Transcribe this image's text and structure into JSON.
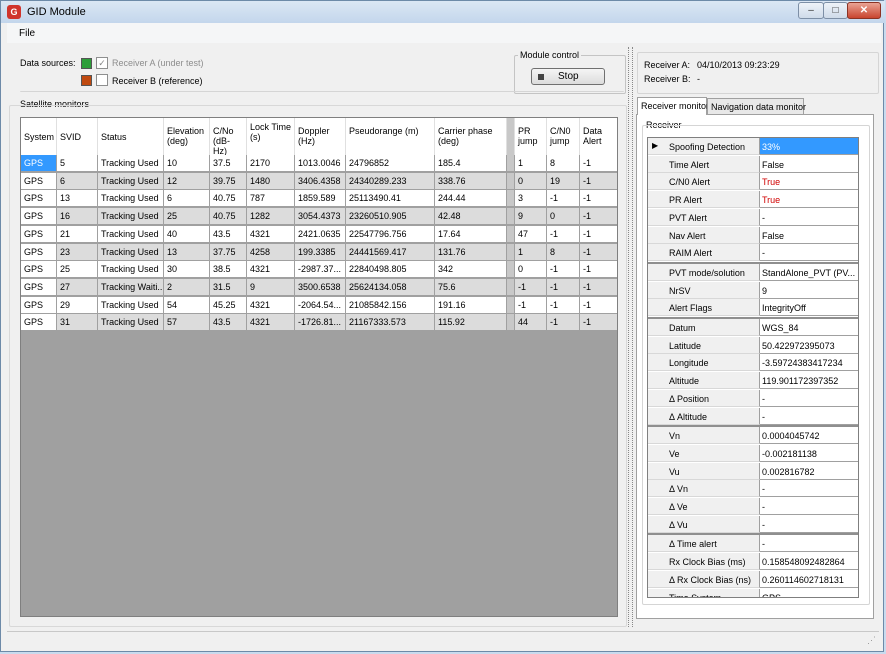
{
  "window": {
    "title": "GID Module",
    "app_icon_letter": "G",
    "min_glyph": "–",
    "max_glyph": "□",
    "close_glyph": "✕"
  },
  "menu": {
    "file": "File"
  },
  "data_sources": {
    "label": "Data sources:",
    "receiver_a": {
      "label": "Receiver A (under test)",
      "checked": true,
      "color": "#2e9e3a"
    },
    "receiver_b": {
      "label": "Receiver B (reference)",
      "checked": false,
      "color": "#c04a10"
    },
    "check_glyph": "✓"
  },
  "module_control": {
    "title": "Module control",
    "stop_label": "Stop",
    "stop_icon": "stop-square-icon"
  },
  "receiver_info": {
    "a_label": "Receiver A:",
    "a_value": "04/10/2013 09:23:29",
    "b_label": "Receiver B:",
    "b_value": "-"
  },
  "satellite_monitors": {
    "title": "Satellite monitors",
    "columns": {
      "system": "System",
      "svid": "SVID",
      "status": "Status",
      "elevation": "Elevation (deg)",
      "cno": "C/No (dB-Hz)",
      "lock": "Lock Time (s)",
      "doppler": "Doppler (Hz)",
      "pseudorange": "Pseudorange (m)",
      "carrier": "Carrier phase (deg)",
      "pr_jump": "PR jump",
      "cn0_jump": "C/N0 jump",
      "data_alert": "Data Alert"
    },
    "rows": [
      [
        "GPS",
        "5",
        "Tracking Used",
        "10",
        "37.5",
        "2170",
        "1013.0046",
        "24796852",
        "185.4",
        "1",
        "8",
        "-1"
      ],
      [
        "GPS",
        "6",
        "Tracking Used",
        "12",
        "39.75",
        "1480",
        "3406.4358",
        "24340289.233",
        "338.76",
        "0",
        "19",
        "-1"
      ],
      [
        "GPS",
        "13",
        "Tracking Used",
        "6",
        "40.75",
        "787",
        "1859.589",
        "25113490.41",
        "244.44",
        "3",
        "-1",
        "-1"
      ],
      [
        "GPS",
        "16",
        "Tracking Used",
        "25",
        "40.75",
        "1282",
        "3054.4373",
        "23260510.905",
        "42.48",
        "9",
        "0",
        "-1"
      ],
      [
        "GPS",
        "21",
        "Tracking Used",
        "40",
        "43.5",
        "4321",
        "2421.0635",
        "22547796.756",
        "17.64",
        "47",
        "-1",
        "-1"
      ],
      [
        "GPS",
        "23",
        "Tracking Used",
        "13",
        "37.75",
        "4258",
        "199.3385",
        "24441569.417",
        "131.76",
        "1",
        "8",
        "-1"
      ],
      [
        "GPS",
        "25",
        "Tracking Used",
        "30",
        "38.5",
        "4321",
        "-2987.37...",
        "22840498.805",
        "342",
        "0",
        "-1",
        "-1"
      ],
      [
        "GPS",
        "27",
        "Tracking Waiti...",
        "2",
        "31.5",
        "9",
        "3500.6538",
        "25624134.058",
        "75.6",
        "-1",
        "-1",
        "-1"
      ],
      [
        "GPS",
        "29",
        "Tracking Used",
        "54",
        "45.25",
        "4321",
        "-2064.54...",
        "21085842.156",
        "191.16",
        "-1",
        "-1",
        "-1"
      ],
      [
        "GPS",
        "31",
        "Tracking Used",
        "57",
        "43.5",
        "4321",
        "-1726.81...",
        "21167333.573",
        "115.92",
        "44",
        "-1",
        "-1"
      ]
    ]
  },
  "tabs": {
    "receiver_monitor": "Receiver monitor",
    "navigation_data_monitor": "Navigation data monitor"
  },
  "receiver_panel": {
    "title": "Receiver",
    "row_arrow": "▶",
    "groups": [
      [
        {
          "name": "Spoofing Detection",
          "value": "33%",
          "selected": true
        },
        {
          "name": "Time Alert",
          "value": "False"
        },
        {
          "name": "C/N0 Alert",
          "value": "True",
          "red": true
        },
        {
          "name": "PR  Alert",
          "value": "True",
          "red": true
        },
        {
          "name": "PVT  Alert",
          "value": "-"
        },
        {
          "name": "Nav  Alert",
          "value": "False"
        },
        {
          "name": "RAIM Alert",
          "value": "-"
        }
      ],
      [
        {
          "name": "PVT mode/solution",
          "value": "StandAlone_PVT (PV..."
        },
        {
          "name": "NrSV",
          "value": "9"
        },
        {
          "name": "Alert Flags",
          "value": "IntegrityOff"
        }
      ],
      [
        {
          "name": "Datum",
          "value": "WGS_84"
        },
        {
          "name": "Latitude",
          "value": "50.422972395073"
        },
        {
          "name": "Longitude",
          "value": "-3.59724383417234"
        },
        {
          "name": "Altitude",
          "value": "119.901172397352"
        },
        {
          "name": "Δ Position",
          "value": "-"
        },
        {
          "name": "Δ Altitude",
          "value": "-"
        }
      ],
      [
        {
          "name": "Vn",
          "value": "0.0004045742"
        },
        {
          "name": "Ve",
          "value": "-0.002181138"
        },
        {
          "name": "Vu",
          "value": "0.002816782"
        },
        {
          "name": "Δ Vn",
          "value": "-"
        },
        {
          "name": "Δ Ve",
          "value": "-"
        },
        {
          "name": "Δ Vu",
          "value": "-"
        }
      ],
      [
        {
          "name": "Δ Time alert",
          "value": "-"
        },
        {
          "name": "Rx Clock Bias (ms)",
          "value": "0.158548092482864"
        },
        {
          "name": "Δ Rx Clock Bias (ns)",
          "value": "0.260114602718131"
        },
        {
          "name": "Time System",
          "value": "GPS"
        }
      ]
    ]
  }
}
